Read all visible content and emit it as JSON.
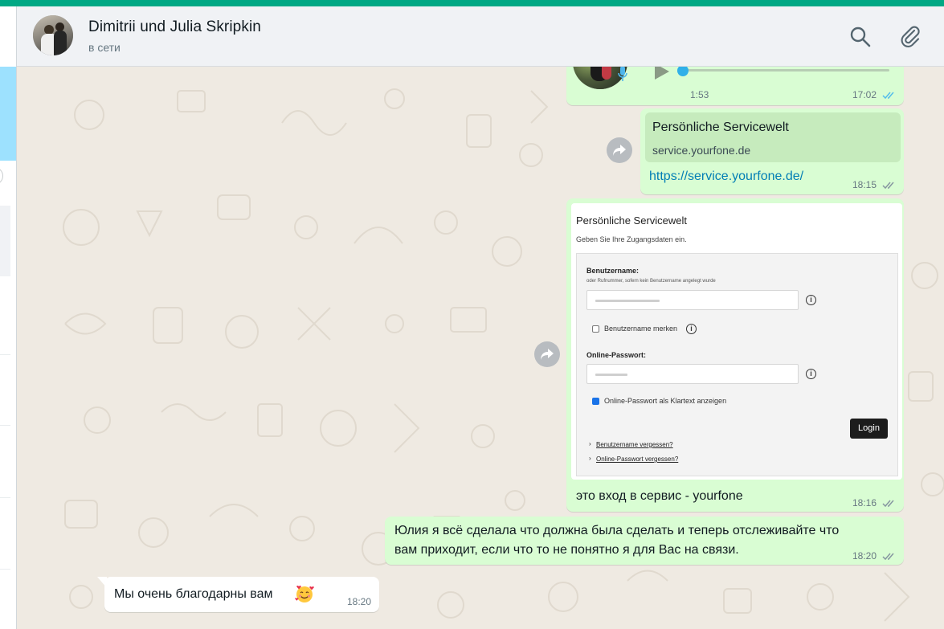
{
  "colors": {
    "accent": "#00a884",
    "outgoing_bubble": "#d9fdd3",
    "incoming_bubble": "#ffffff",
    "link": "#027eb5",
    "ticks_read": "#53bdeb",
    "ticks_delivered": "#8696a0"
  },
  "header": {
    "contact_name": "Dimitrii und Julia Skripkin",
    "status": "в сети",
    "search_icon": "search-icon",
    "attach_icon": "paperclip-icon"
  },
  "messages": {
    "voice": {
      "duration": "1:53",
      "time": "17:02",
      "progress": 0,
      "status": "read"
    },
    "link": {
      "card_title": "Persönliche Servicewelt",
      "card_domain": "service.yourfone.de",
      "url": "https://service.yourfone.de/",
      "time": "18:15",
      "status": "delivered"
    },
    "image": {
      "caption": "это вход в сервис - yourfone",
      "time": "18:16",
      "status": "delivered",
      "screenshot": {
        "title": "Persönliche Servicewelt",
        "subtitle": "Geben Sie Ihre Zugangsdaten ein.",
        "username_label": "Benutzername:",
        "username_hint": "oder Rufnummer, sofern kein Benutzername angelegt wurde",
        "remember_label": "Benutzername merken",
        "password_label": "Online-Passwort:",
        "show_password_label": "Online-Passwort als Klartext anzeigen",
        "login_button": "Login",
        "forgot_username": "Benutzername vergessen?",
        "forgot_password": "Online-Passwort vergessen?",
        "info_glyph": "i",
        "arrow_glyph": "›"
      }
    },
    "text_out": {
      "line1": "Юлия я всё сделала что должна была сделать и теперь отслеживайте что",
      "line2": "вам приходит, если что то не понятно я для Вас на связи.",
      "time": "18:20",
      "status": "delivered"
    },
    "text_in": {
      "text": "Мы очень благодарны вам",
      "emoji": "smiling-face-with-hearts-icon",
      "time": "18:20"
    }
  }
}
